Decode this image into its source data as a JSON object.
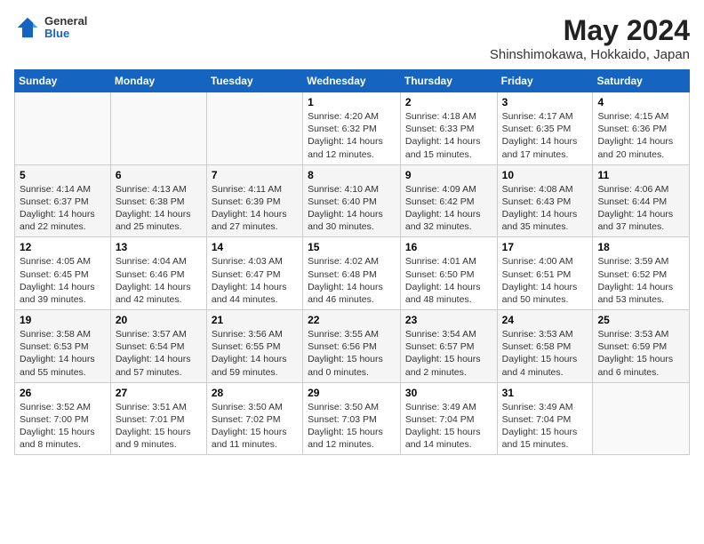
{
  "header": {
    "logo_general": "General",
    "logo_blue": "Blue",
    "title": "May 2024",
    "subtitle": "Shinshimokawa, Hokkaido, Japan"
  },
  "weekdays": [
    "Sunday",
    "Monday",
    "Tuesday",
    "Wednesday",
    "Thursday",
    "Friday",
    "Saturday"
  ],
  "weeks": [
    [
      {
        "day": "",
        "sunrise": "",
        "sunset": "",
        "daylight": ""
      },
      {
        "day": "",
        "sunrise": "",
        "sunset": "",
        "daylight": ""
      },
      {
        "day": "",
        "sunrise": "",
        "sunset": "",
        "daylight": ""
      },
      {
        "day": "1",
        "sunrise": "4:20 AM",
        "sunset": "6:32 PM",
        "daylight": "14 hours and 12 minutes."
      },
      {
        "day": "2",
        "sunrise": "4:18 AM",
        "sunset": "6:33 PM",
        "daylight": "14 hours and 15 minutes."
      },
      {
        "day": "3",
        "sunrise": "4:17 AM",
        "sunset": "6:35 PM",
        "daylight": "14 hours and 17 minutes."
      },
      {
        "day": "4",
        "sunrise": "4:15 AM",
        "sunset": "6:36 PM",
        "daylight": "14 hours and 20 minutes."
      }
    ],
    [
      {
        "day": "5",
        "sunrise": "4:14 AM",
        "sunset": "6:37 PM",
        "daylight": "14 hours and 22 minutes."
      },
      {
        "day": "6",
        "sunrise": "4:13 AM",
        "sunset": "6:38 PM",
        "daylight": "14 hours and 25 minutes."
      },
      {
        "day": "7",
        "sunrise": "4:11 AM",
        "sunset": "6:39 PM",
        "daylight": "14 hours and 27 minutes."
      },
      {
        "day": "8",
        "sunrise": "4:10 AM",
        "sunset": "6:40 PM",
        "daylight": "14 hours and 30 minutes."
      },
      {
        "day": "9",
        "sunrise": "4:09 AM",
        "sunset": "6:42 PM",
        "daylight": "14 hours and 32 minutes."
      },
      {
        "day": "10",
        "sunrise": "4:08 AM",
        "sunset": "6:43 PM",
        "daylight": "14 hours and 35 minutes."
      },
      {
        "day": "11",
        "sunrise": "4:06 AM",
        "sunset": "6:44 PM",
        "daylight": "14 hours and 37 minutes."
      }
    ],
    [
      {
        "day": "12",
        "sunrise": "4:05 AM",
        "sunset": "6:45 PM",
        "daylight": "14 hours and 39 minutes."
      },
      {
        "day": "13",
        "sunrise": "4:04 AM",
        "sunset": "6:46 PM",
        "daylight": "14 hours and 42 minutes."
      },
      {
        "day": "14",
        "sunrise": "4:03 AM",
        "sunset": "6:47 PM",
        "daylight": "14 hours and 44 minutes."
      },
      {
        "day": "15",
        "sunrise": "4:02 AM",
        "sunset": "6:48 PM",
        "daylight": "14 hours and 46 minutes."
      },
      {
        "day": "16",
        "sunrise": "4:01 AM",
        "sunset": "6:50 PM",
        "daylight": "14 hours and 48 minutes."
      },
      {
        "day": "17",
        "sunrise": "4:00 AM",
        "sunset": "6:51 PM",
        "daylight": "14 hours and 50 minutes."
      },
      {
        "day": "18",
        "sunrise": "3:59 AM",
        "sunset": "6:52 PM",
        "daylight": "14 hours and 53 minutes."
      }
    ],
    [
      {
        "day": "19",
        "sunrise": "3:58 AM",
        "sunset": "6:53 PM",
        "daylight": "14 hours and 55 minutes."
      },
      {
        "day": "20",
        "sunrise": "3:57 AM",
        "sunset": "6:54 PM",
        "daylight": "14 hours and 57 minutes."
      },
      {
        "day": "21",
        "sunrise": "3:56 AM",
        "sunset": "6:55 PM",
        "daylight": "14 hours and 59 minutes."
      },
      {
        "day": "22",
        "sunrise": "3:55 AM",
        "sunset": "6:56 PM",
        "daylight": "15 hours and 0 minutes."
      },
      {
        "day": "23",
        "sunrise": "3:54 AM",
        "sunset": "6:57 PM",
        "daylight": "15 hours and 2 minutes."
      },
      {
        "day": "24",
        "sunrise": "3:53 AM",
        "sunset": "6:58 PM",
        "daylight": "15 hours and 4 minutes."
      },
      {
        "day": "25",
        "sunrise": "3:53 AM",
        "sunset": "6:59 PM",
        "daylight": "15 hours and 6 minutes."
      }
    ],
    [
      {
        "day": "26",
        "sunrise": "3:52 AM",
        "sunset": "7:00 PM",
        "daylight": "15 hours and 8 minutes."
      },
      {
        "day": "27",
        "sunrise": "3:51 AM",
        "sunset": "7:01 PM",
        "daylight": "15 hours and 9 minutes."
      },
      {
        "day": "28",
        "sunrise": "3:50 AM",
        "sunset": "7:02 PM",
        "daylight": "15 hours and 11 minutes."
      },
      {
        "day": "29",
        "sunrise": "3:50 AM",
        "sunset": "7:03 PM",
        "daylight": "15 hours and 12 minutes."
      },
      {
        "day": "30",
        "sunrise": "3:49 AM",
        "sunset": "7:04 PM",
        "daylight": "15 hours and 14 minutes."
      },
      {
        "day": "31",
        "sunrise": "3:49 AM",
        "sunset": "7:04 PM",
        "daylight": "15 hours and 15 minutes."
      },
      {
        "day": "",
        "sunrise": "",
        "sunset": "",
        "daylight": ""
      }
    ]
  ]
}
